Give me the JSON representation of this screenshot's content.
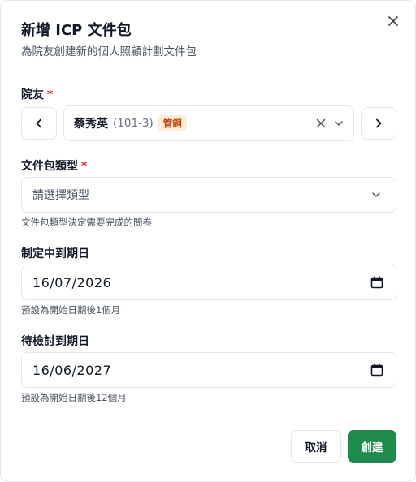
{
  "dialog": {
    "title": "新增 ICP 文件包",
    "subtitle": "為院友創建新的個人照顧計劃文件包",
    "close_icon": "close-icon"
  },
  "resident_field": {
    "label": "院友",
    "required_mark": "*",
    "prev_icon": "chevron-left-icon",
    "next_icon": "chevron-right-icon",
    "selected": {
      "name": "蔡秀英",
      "room": "(101-3)",
      "badge": "管飼"
    },
    "clear_icon": "clear-x-icon",
    "dropdown_icon": "chevron-down-icon"
  },
  "package_type_field": {
    "label": "文件包類型",
    "required_mark": "*",
    "placeholder": "請選擇類型",
    "hint": "文件包類型決定需要完成的問卷"
  },
  "due_date_field": {
    "label": "制定中到期日",
    "value": "16/07/2026",
    "hint": "預設為開始日期後1個月"
  },
  "review_date_field": {
    "label": "待檢討到期日",
    "value": "16/06/2027",
    "hint": "預設為開始日期後12個月"
  },
  "actions": {
    "cancel_label": "取消",
    "create_label": "創建"
  },
  "colors": {
    "primary": "#1f8a4c",
    "required": "#dc2626",
    "badge_bg": "#ffedd5",
    "badge_text": "#c2410c"
  }
}
